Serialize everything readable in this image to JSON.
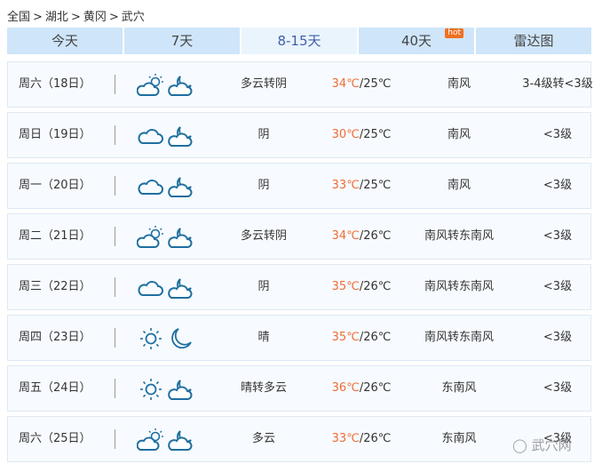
{
  "breadcrumb": [
    "全国",
    ">",
    "湖北",
    ">",
    "黄冈",
    ">",
    "武穴"
  ],
  "tabs": [
    {
      "label": "今天"
    },
    {
      "label": "7天"
    },
    {
      "label": "8-15天",
      "active": true
    },
    {
      "label": "40天",
      "badge": "hot"
    },
    {
      "label": "雷达图"
    }
  ],
  "days": [
    {
      "date": "周六（18日）",
      "day_icon": "cloud-sun",
      "night_icon": "moon-cloud",
      "weather": "多云转阴",
      "high": "34℃",
      "low": "/25℃",
      "wind": "南风",
      "level": "3-4级转<3级"
    },
    {
      "date": "周日（19日）",
      "day_icon": "cloud",
      "night_icon": "moon-cloud",
      "weather": "阴",
      "high": "30℃",
      "low": "/25℃",
      "wind": "南风",
      "level": "<3级"
    },
    {
      "date": "周一（20日）",
      "day_icon": "cloud",
      "night_icon": "moon-cloud",
      "weather": "阴",
      "high": "33℃",
      "low": "/25℃",
      "wind": "南风",
      "level": "<3级"
    },
    {
      "date": "周二（21日）",
      "day_icon": "cloud-sun",
      "night_icon": "moon-cloud",
      "weather": "多云转阴",
      "high": "34℃",
      "low": "/26℃",
      "wind": "南风转东南风",
      "level": "<3级"
    },
    {
      "date": "周三（22日）",
      "day_icon": "cloud",
      "night_icon": "moon-cloud",
      "weather": "阴",
      "high": "35℃",
      "low": "/26℃",
      "wind": "南风转东南风",
      "level": "<3级"
    },
    {
      "date": "周四（23日）",
      "day_icon": "sun",
      "night_icon": "moon",
      "weather": "晴",
      "high": "35℃",
      "low": "/26℃",
      "wind": "南风转东南风",
      "level": "<3级"
    },
    {
      "date": "周五（24日）",
      "day_icon": "sun",
      "night_icon": "moon-cloud",
      "weather": "晴转多云",
      "high": "36℃",
      "low": "/26℃",
      "wind": "东南风",
      "level": "<3级"
    },
    {
      "date": "周六（25日）",
      "day_icon": "cloud-sun",
      "night_icon": "moon-cloud",
      "weather": "多云",
      "high": "33℃",
      "low": "/26℃",
      "wind": "东南风",
      "level": "<3级"
    }
  ],
  "watermark": "武穴网"
}
